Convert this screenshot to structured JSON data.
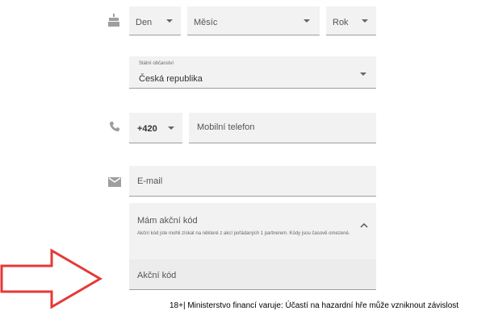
{
  "dob": {
    "day_label": "Den",
    "month_label": "Měsíc",
    "year_label": "Rok",
    "icon": "cake-icon"
  },
  "citizenship": {
    "label": "Státní občanství",
    "value": "Česká republika"
  },
  "phone": {
    "icon": "phone-icon",
    "prefix": "+420",
    "placeholder": "Mobilní telefon"
  },
  "email": {
    "icon": "mail-icon",
    "placeholder": "E-mail"
  },
  "promo": {
    "toggle_label": "Mám akční kód",
    "hint": "Akční kód jste mohli získat na některé z akcí pořádaných 1 partnerem. Kódy jsou časově omezené.",
    "input_placeholder": "Akční kód"
  },
  "annotation": {
    "arrow_color": "#e53935"
  },
  "footer": {
    "warning": "18+| Ministerstvo financí varuje: Účastí na hazardní hře může vzniknout závislost"
  }
}
